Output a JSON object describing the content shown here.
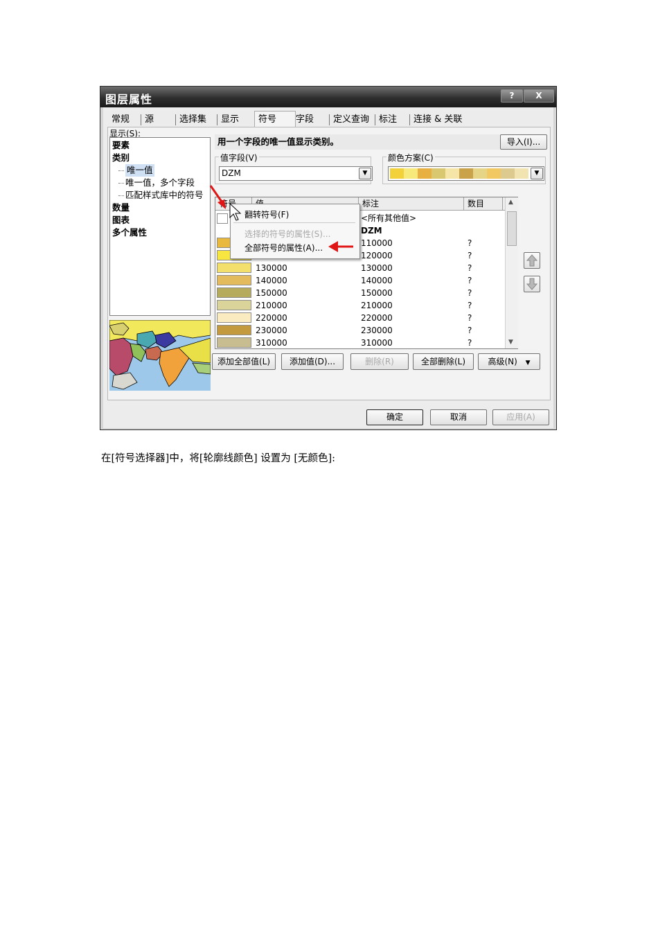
{
  "dialog": {
    "title": "图层属性",
    "help_btn": "?",
    "close_btn": "X",
    "tabs": [
      "常规",
      "源",
      "选择集",
      "显示",
      "符号",
      "字段",
      "定义查询",
      "标注",
      "连接 & 关联"
    ],
    "active_tab": "符号"
  },
  "show_panel": {
    "label": "显示(S):",
    "tree": [
      {
        "label": "要素",
        "bold": true,
        "level": 0
      },
      {
        "label": "类别",
        "bold": true,
        "level": 0
      },
      {
        "label": "唯一值",
        "bold": false,
        "level": 1,
        "selected": true
      },
      {
        "label": "唯一值，多个字段",
        "bold": false,
        "level": 1
      },
      {
        "label": "匹配样式库中的符号",
        "bold": false,
        "level": 1
      },
      {
        "label": "数量",
        "bold": true,
        "level": 0
      },
      {
        "label": "图表",
        "bold": true,
        "level": 0
      },
      {
        "label": "多个属性",
        "bold": true,
        "level": 0
      }
    ]
  },
  "main": {
    "description": "用一个字段的唯一值显示类别。",
    "import_btn": "导入(I)...",
    "value_field_label": "值字段(V)",
    "value_field_value": "DZM",
    "color_scheme_label": "颜色方案(C)",
    "color_scheme": [
      "#f2d13a",
      "#f7e97a",
      "#e8b040",
      "#d9c870",
      "#f5e6a8",
      "#c9a24a",
      "#e6d487",
      "#f1c862",
      "#dcca8e",
      "#f2e4b0"
    ]
  },
  "table": {
    "headers": {
      "symbol": "符号",
      "value": "值",
      "label": "标注",
      "count": "数目"
    },
    "all_other": "<所有其他值>",
    "heading": "DZM",
    "rows": [
      {
        "color": "#e9b93e",
        "value": "110000",
        "label": "110000",
        "count": "?"
      },
      {
        "color": "#f7e640",
        "value": "120000",
        "label": "120000",
        "count": "?"
      },
      {
        "color": "#f3df6c",
        "value": "130000",
        "label": "130000",
        "count": "?"
      },
      {
        "color": "#e3bb5c",
        "value": "140000",
        "label": "140000",
        "count": "?"
      },
      {
        "color": "#b6ab5d",
        "value": "150000",
        "label": "150000",
        "count": "?"
      },
      {
        "color": "#dbd49a",
        "value": "210000",
        "label": "210000",
        "count": "?"
      },
      {
        "color": "#faebc0",
        "value": "220000",
        "label": "220000",
        "count": "?"
      },
      {
        "color": "#c49a3e",
        "value": "230000",
        "label": "230000",
        "count": "?"
      },
      {
        "color": "#c8bd90",
        "value": "310000",
        "label": "310000",
        "count": "?"
      }
    ]
  },
  "context_menu": {
    "items": [
      {
        "label": "翻转符号(F)",
        "enabled": true
      },
      {
        "label": "选择的符号的属性(S)...",
        "enabled": false
      },
      {
        "label": "全部符号的属性(A)...",
        "enabled": true
      }
    ]
  },
  "actions": {
    "add_all": "添加全部值(L)",
    "add": "添加值(D)...",
    "remove": "删除(R)",
    "remove_all": "全部删除(L)",
    "advanced": "高级(N)"
  },
  "footer": {
    "ok": "确定",
    "cancel": "取消",
    "apply": "应用(A)"
  },
  "colors": {
    "arrow": "#e01515",
    "title_bar": "#2e2e2e"
  },
  "caption": "在[符号选择器]中，将[轮廓线颜色] 设置为 [无颜色]:"
}
